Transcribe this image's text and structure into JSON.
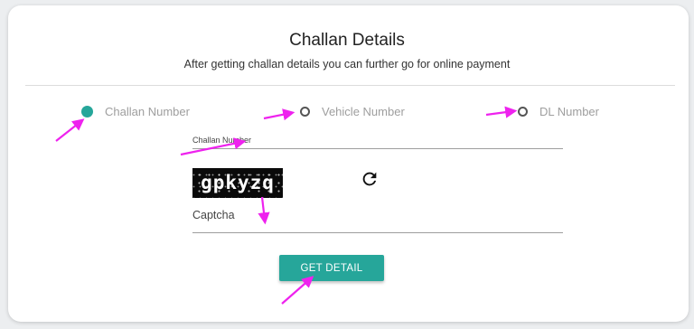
{
  "header": {
    "title": "Challan Details",
    "subtitle": "After getting challan details you can further go for online payment"
  },
  "search_options": [
    {
      "label": "Challan Number",
      "selected": true
    },
    {
      "label": "Vehicle Number",
      "selected": false
    },
    {
      "label": "DL Number",
      "selected": false
    }
  ],
  "challan_field": {
    "label": "Challan Number",
    "value": ""
  },
  "captcha": {
    "text": "gpkyzq",
    "label": "Captcha",
    "value": ""
  },
  "submit": {
    "label": "GET DETAIL"
  },
  "colors": {
    "accent": "#26a69a",
    "annotation_arrow": "#ee22ee"
  },
  "icons": {
    "refresh": "refresh-icon"
  }
}
